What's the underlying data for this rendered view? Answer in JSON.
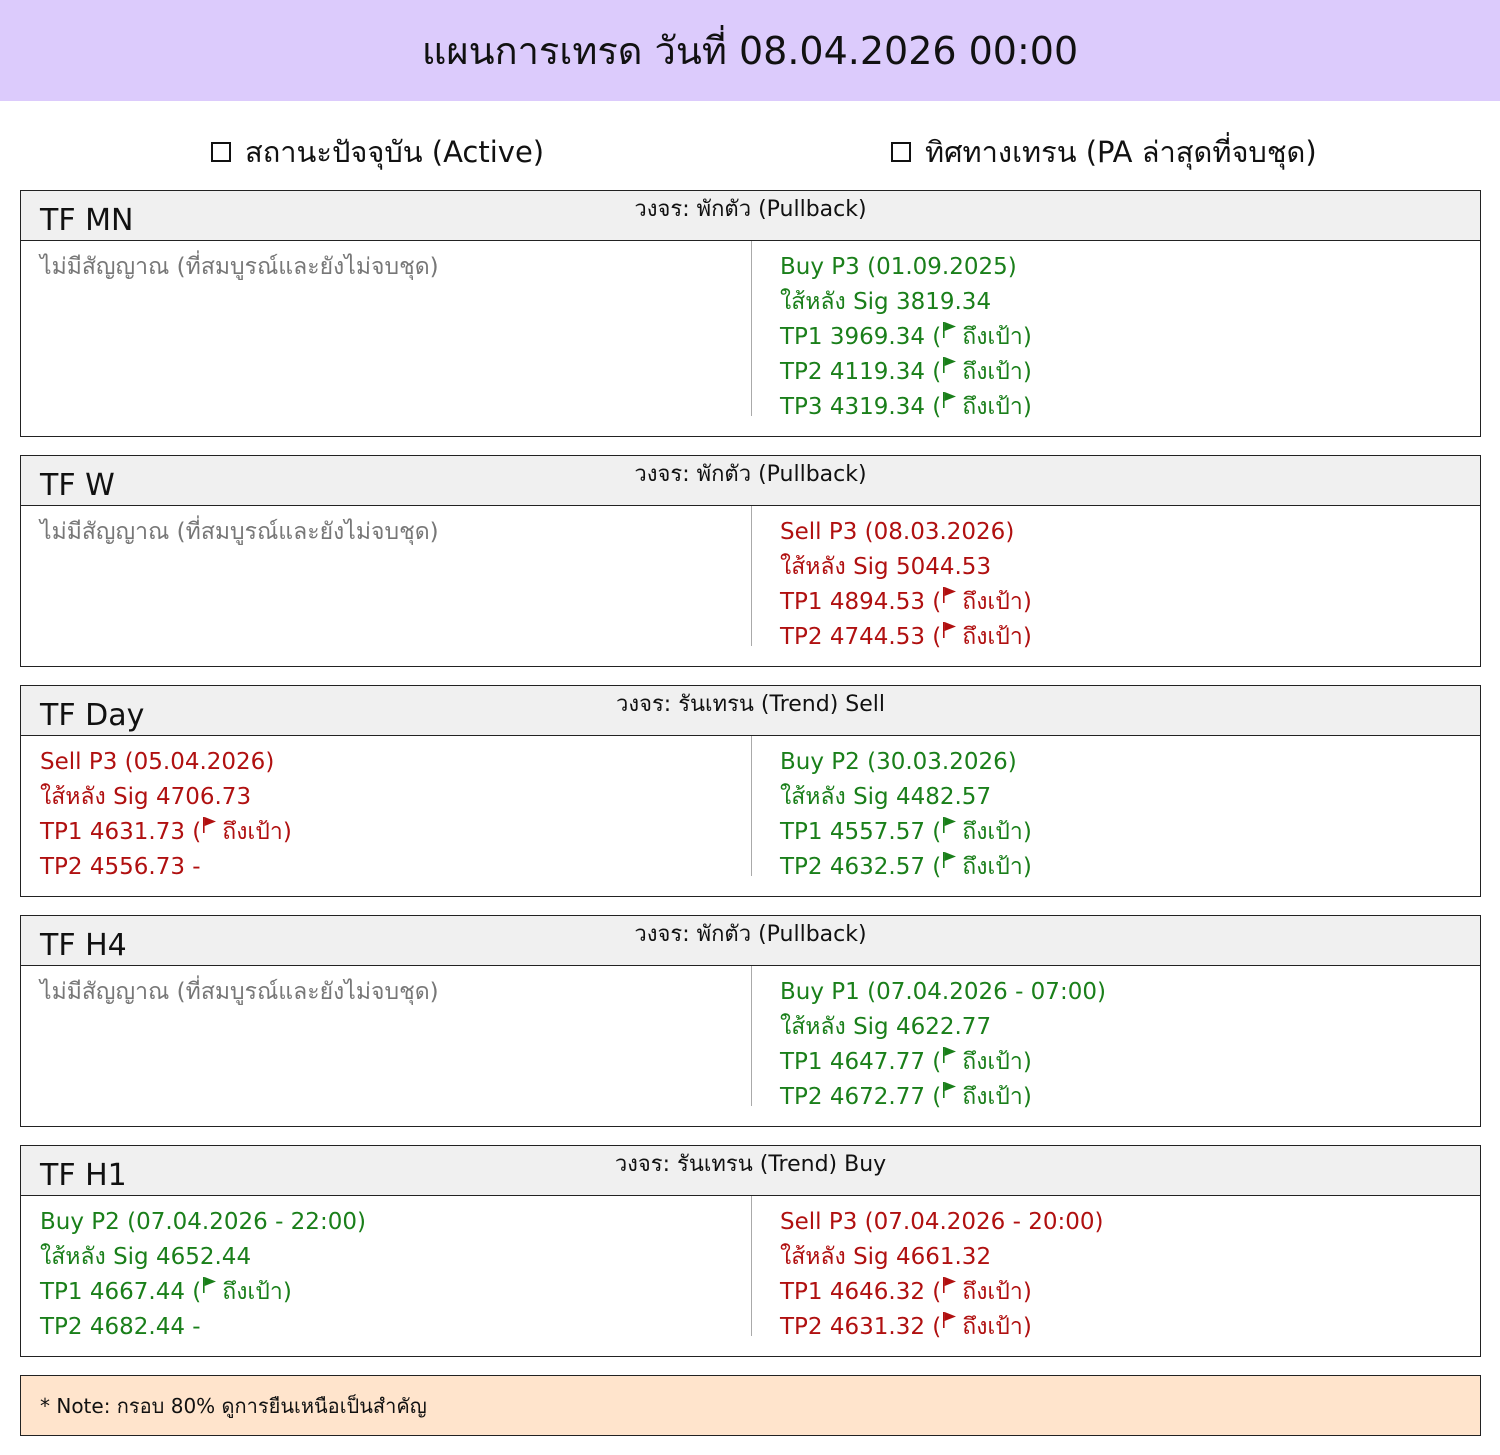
{
  "header": {
    "title": "แผนการเทรด วันที่ 08.04.2026 00:00"
  },
  "columns": {
    "left": "สถานะปัจจุบัน (Active)",
    "right": "ทิศทางเทรน (PA ล่าสุดที่จบชุด)"
  },
  "flag_text": "ถึงเป้า",
  "colors": {
    "buy": "#1a7f1a",
    "sell": "#b01010",
    "none": "#777777",
    "header_bg": "#dccbfc",
    "note_bg": "#ffe4cc"
  },
  "panels": [
    {
      "tf": "TF MN",
      "cycle": "วงจร: พักตัว (Pullback)",
      "left": {
        "color": "none",
        "lines": [
          {
            "text": "ไม่มีสัญญาณ (ที่สมบูรณ์และยังไม่จบชุด)"
          }
        ]
      },
      "right": {
        "color": "buy",
        "lines": [
          {
            "text": "Buy P3 (01.09.2025)"
          },
          {
            "text": "ใส้หลัง Sig  3819.34"
          },
          {
            "text": "TP1 3969.34 (",
            "flag": true,
            "after": ")"
          },
          {
            "text": "TP2 4119.34 (",
            "flag": true,
            "after": ")"
          },
          {
            "text": "TP3 4319.34 (",
            "flag": true,
            "after": ")"
          }
        ]
      }
    },
    {
      "tf": "TF W",
      "cycle": "วงจร: พักตัว (Pullback)",
      "left": {
        "color": "none",
        "lines": [
          {
            "text": "ไม่มีสัญญาณ (ที่สมบูรณ์และยังไม่จบชุด)"
          }
        ]
      },
      "right": {
        "color": "sell",
        "lines": [
          {
            "text": "Sell P3 (08.03.2026)"
          },
          {
            "text": "ใส้หลัง Sig  5044.53"
          },
          {
            "text": "TP1 4894.53 (",
            "flag": true,
            "after": ")"
          },
          {
            "text": "TP2 4744.53 (",
            "flag": true,
            "after": ")"
          }
        ]
      }
    },
    {
      "tf": "TF Day",
      "cycle": "วงจร: รันเทรน (Trend) Sell",
      "left": {
        "color": "sell",
        "lines": [
          {
            "text": "Sell P3 (05.04.2026)"
          },
          {
            "text": "ใส้หลัง Sig  4706.73"
          },
          {
            "text": "TP1 4631.73 (",
            "flag": true,
            "after": ")"
          },
          {
            "text": "TP2 4556.73  -"
          }
        ]
      },
      "right": {
        "color": "buy",
        "lines": [
          {
            "text": "Buy P2 (30.03.2026)"
          },
          {
            "text": "ใส้หลัง Sig  4482.57"
          },
          {
            "text": "TP1 4557.57 (",
            "flag": true,
            "after": ")"
          },
          {
            "text": "TP2 4632.57 (",
            "flag": true,
            "after": ")"
          }
        ]
      }
    },
    {
      "tf": "TF H4",
      "cycle": "วงจร: พักตัว (Pullback)",
      "left": {
        "color": "none",
        "lines": [
          {
            "text": "ไม่มีสัญญาณ (ที่สมบูรณ์และยังไม่จบชุด)"
          }
        ]
      },
      "right": {
        "color": "buy",
        "lines": [
          {
            "text": "Buy P1 (07.04.2026 - 07:00)"
          },
          {
            "text": "ใส้หลัง Sig  4622.77"
          },
          {
            "text": "TP1 4647.77 (",
            "flag": true,
            "after": ")"
          },
          {
            "text": "TP2 4672.77 (",
            "flag": true,
            "after": ")"
          }
        ]
      }
    },
    {
      "tf": "TF H1",
      "cycle": "วงจร: รันเทรน (Trend) Buy",
      "left": {
        "color": "buy",
        "lines": [
          {
            "text": "Buy P2 (07.04.2026 - 22:00)"
          },
          {
            "text": "ใส้หลัง Sig  4652.44"
          },
          {
            "text": "TP1 4667.44 (",
            "flag": true,
            "after": ")"
          },
          {
            "text": "TP2 4682.44  -"
          }
        ]
      },
      "right": {
        "color": "sell",
        "lines": [
          {
            "text": "Sell P3 (07.04.2026 - 20:00)"
          },
          {
            "text": "ใส้หลัง Sig  4661.32"
          },
          {
            "text": "TP1 4646.32 (",
            "flag": true,
            "after": ")"
          },
          {
            "text": "TP2 4631.32 (",
            "flag": true,
            "after": ")"
          }
        ]
      }
    }
  ],
  "note": "* Note: กรอบ 80% ดูการยืนเหนือเป็นสำคัญ"
}
